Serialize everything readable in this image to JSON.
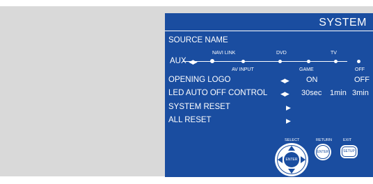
{
  "screen": {
    "title": "SYSTEM",
    "background": "#1a4da0",
    "foreground": "#ffffff"
  },
  "source_name": {
    "label": "SOURCE NAME",
    "current_value": "AUX",
    "arrow_icon": "left-right-arrows-icon",
    "options_top": [
      "NAVI LINK",
      "DVD",
      "TV"
    ],
    "options_bottom": [
      "AV INPUT",
      "GAME",
      "OFF"
    ]
  },
  "opening_logo": {
    "label": "OPENING LOGO",
    "arrow_icon": "left-right-arrows-icon",
    "options": [
      "ON",
      "OFF"
    ]
  },
  "led_auto_off": {
    "label": "LED AUTO OFF CONTROL",
    "arrow_icon": "left-right-arrows-icon",
    "options": [
      "30sec",
      "1min",
      "3min"
    ]
  },
  "system_reset": {
    "label": "SYSTEM RESET",
    "arrow_icon": "right-arrow-icon"
  },
  "all_reset": {
    "label": "ALL RESET",
    "arrow_icon": "right-arrow-icon"
  },
  "controls": {
    "select_caption": "SELECT",
    "return_caption": "RETURN",
    "exit_caption": "EXIT",
    "enter_label": "ENTER",
    "return_button_label": "ENTER",
    "exit_button_label": "SETUP"
  }
}
